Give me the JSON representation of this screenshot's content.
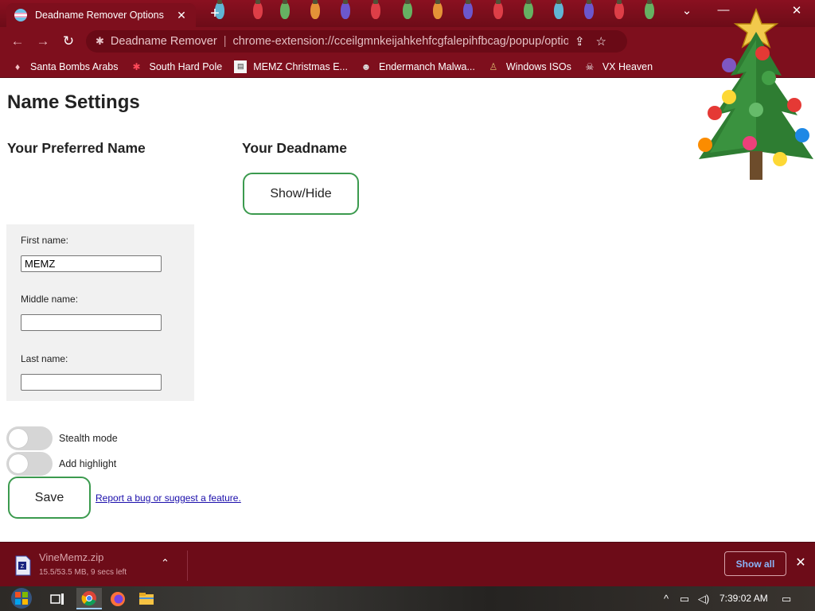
{
  "browser": {
    "tab_title": "Deadname Remover Options",
    "tab_close": "✕",
    "new_tab": "+",
    "window_controls": {
      "tab_search": "⌄",
      "minimize": "—",
      "maximize": "☐",
      "close": "✕"
    },
    "nav": {
      "back": "←",
      "forward": "→",
      "reload": "↻"
    },
    "omnibox": {
      "site_name": "Deadname Remover",
      "separator": "|",
      "url": "chrome-extension://cceilgmnkeijahkehfcgfalepihfbcag/popup/optio...",
      "share_icon": "⇪",
      "star_icon": "☆"
    },
    "menu_icon": "⋮",
    "bookmarks": [
      {
        "label": "Santa Bombs Arabs",
        "icon": "bomb-icon"
      },
      {
        "label": "South Hard Pole",
        "icon": "snowflake-icon"
      },
      {
        "label": "MEMZ Christmas E...",
        "icon": "page-icon"
      },
      {
        "label": "Endermanch Malwa...",
        "icon": "raccoon-icon"
      },
      {
        "label": "Windows ISOs",
        "icon": "person-icon"
      },
      {
        "label": "VX Heaven",
        "icon": "skull-icon"
      }
    ]
  },
  "page": {
    "title": "Name Settings",
    "preferred_heading": "Your Preferred Name",
    "deadname_heading": "Your Deadname",
    "show_hide_label": "Show/Hide",
    "fields": {
      "first_label": "First name:",
      "first_value": "MEMZ",
      "middle_label": "Middle name:",
      "middle_value": "",
      "last_label": "Last name:",
      "last_value": ""
    },
    "toggles": {
      "stealth_label": "Stealth mode",
      "stealth_on": false,
      "highlight_label": "Add highlight",
      "highlight_on": false
    },
    "save_label": "Save",
    "report_link": "Report a bug or suggest a feature."
  },
  "download": {
    "filename": "VineMemz.zip",
    "status": "15.5/53.5 MB, 9 secs left",
    "chevron": "⌃",
    "show_all": "Show all",
    "close": "✕"
  },
  "taskbar": {
    "clock": "7:39:02 AM",
    "tray_icons": [
      "chevron-up-icon",
      "network-icon",
      "volume-icon"
    ],
    "apps": [
      "task-view-icon",
      "chrome-icon",
      "firefox-icon",
      "file-explorer-icon"
    ]
  },
  "colors": {
    "browser_frame": "#7e0f1d",
    "accent_green": "#3b9a4e",
    "panel_gray": "#f1f1f1",
    "link_blue": "#1a0dab"
  }
}
